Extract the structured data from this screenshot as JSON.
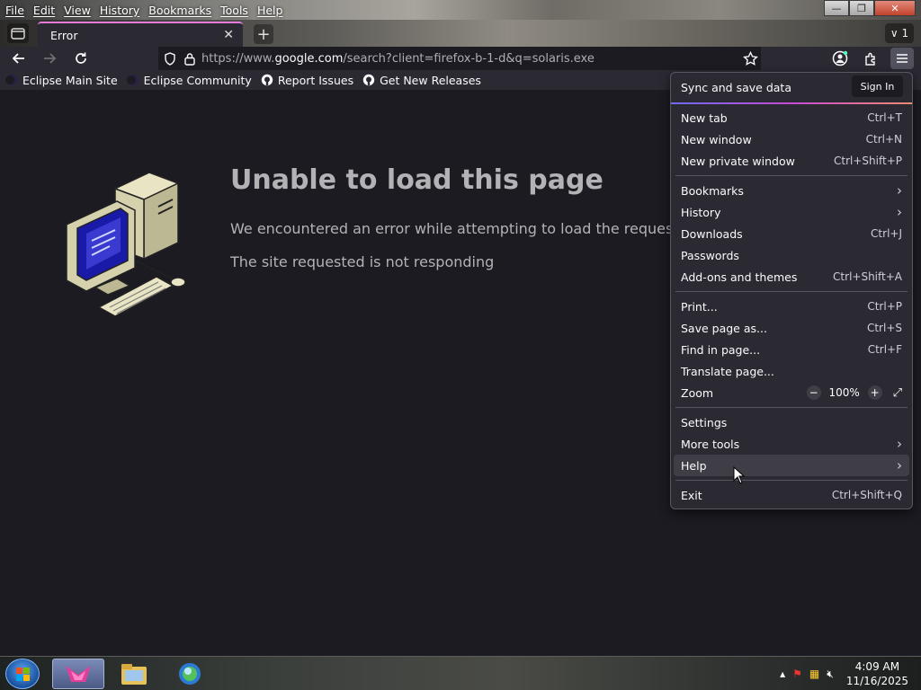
{
  "menubar": {
    "items": [
      "File",
      "Edit",
      "View",
      "History",
      "Bookmarks",
      "Tools",
      "Help"
    ]
  },
  "window_controls": {
    "minimize": "—",
    "maximize": "❐",
    "close": "✕"
  },
  "tab": {
    "title": "Error",
    "close": "✕"
  },
  "tabstrip": {
    "new_tab": "+",
    "all_tabs": "∨ 1"
  },
  "url": {
    "prefix": "https://www.",
    "domain": "google.com",
    "path": "/search?client=firefox-b-1-d&q=solaris.exe"
  },
  "bookmarks": [
    {
      "label": "Eclipse Main Site",
      "icon": "eclipse-icon"
    },
    {
      "label": "Eclipse Community",
      "icon": "eclipse-icon"
    },
    {
      "label": "Report Issues",
      "icon": "github-icon"
    },
    {
      "label": "Get New Releases",
      "icon": "github-icon"
    }
  ],
  "error": {
    "title": "Unable to load this page",
    "description": "We encountered an error while attempting to load the requested URL",
    "detail": "The site requested is not responding"
  },
  "appmenu": {
    "sync_label": "Sync and save data",
    "sign_in": "Sign In",
    "items": [
      {
        "label": "New tab",
        "shortcut": "Ctrl+T"
      },
      {
        "label": "New window",
        "shortcut": "Ctrl+N"
      },
      {
        "label": "New private window",
        "shortcut": "Ctrl+Shift+P"
      },
      {
        "label": "Bookmarks",
        "shortcut": ""
      },
      {
        "label": "History",
        "shortcut": ""
      },
      {
        "label": "Downloads",
        "shortcut": "Ctrl+J"
      },
      {
        "label": "Passwords",
        "shortcut": ""
      },
      {
        "label": "Add-ons and themes",
        "shortcut": "Ctrl+Shift+A"
      },
      {
        "label": "Print...",
        "shortcut": "Ctrl+P"
      },
      {
        "label": "Save page as...",
        "shortcut": "Ctrl+S"
      },
      {
        "label": "Find in page...",
        "shortcut": "Ctrl+F"
      },
      {
        "label": "Translate page...",
        "shortcut": ""
      },
      {
        "label": "Zoom",
        "shortcut": ""
      },
      {
        "label": "Settings",
        "shortcut": ""
      },
      {
        "label": "More tools",
        "shortcut": ""
      },
      {
        "label": "Help",
        "shortcut": ""
      },
      {
        "label": "Exit",
        "shortcut": "Ctrl+Shift+Q"
      }
    ],
    "zoom": {
      "minus": "−",
      "value": "100%",
      "plus": "+"
    }
  },
  "taskbar": {
    "time": "4:09 AM",
    "date": "11/16/2025"
  },
  "colors": {
    "accent": "#e27ad9",
    "background": "#1c1b22",
    "toolbar": "#2b2a33"
  }
}
